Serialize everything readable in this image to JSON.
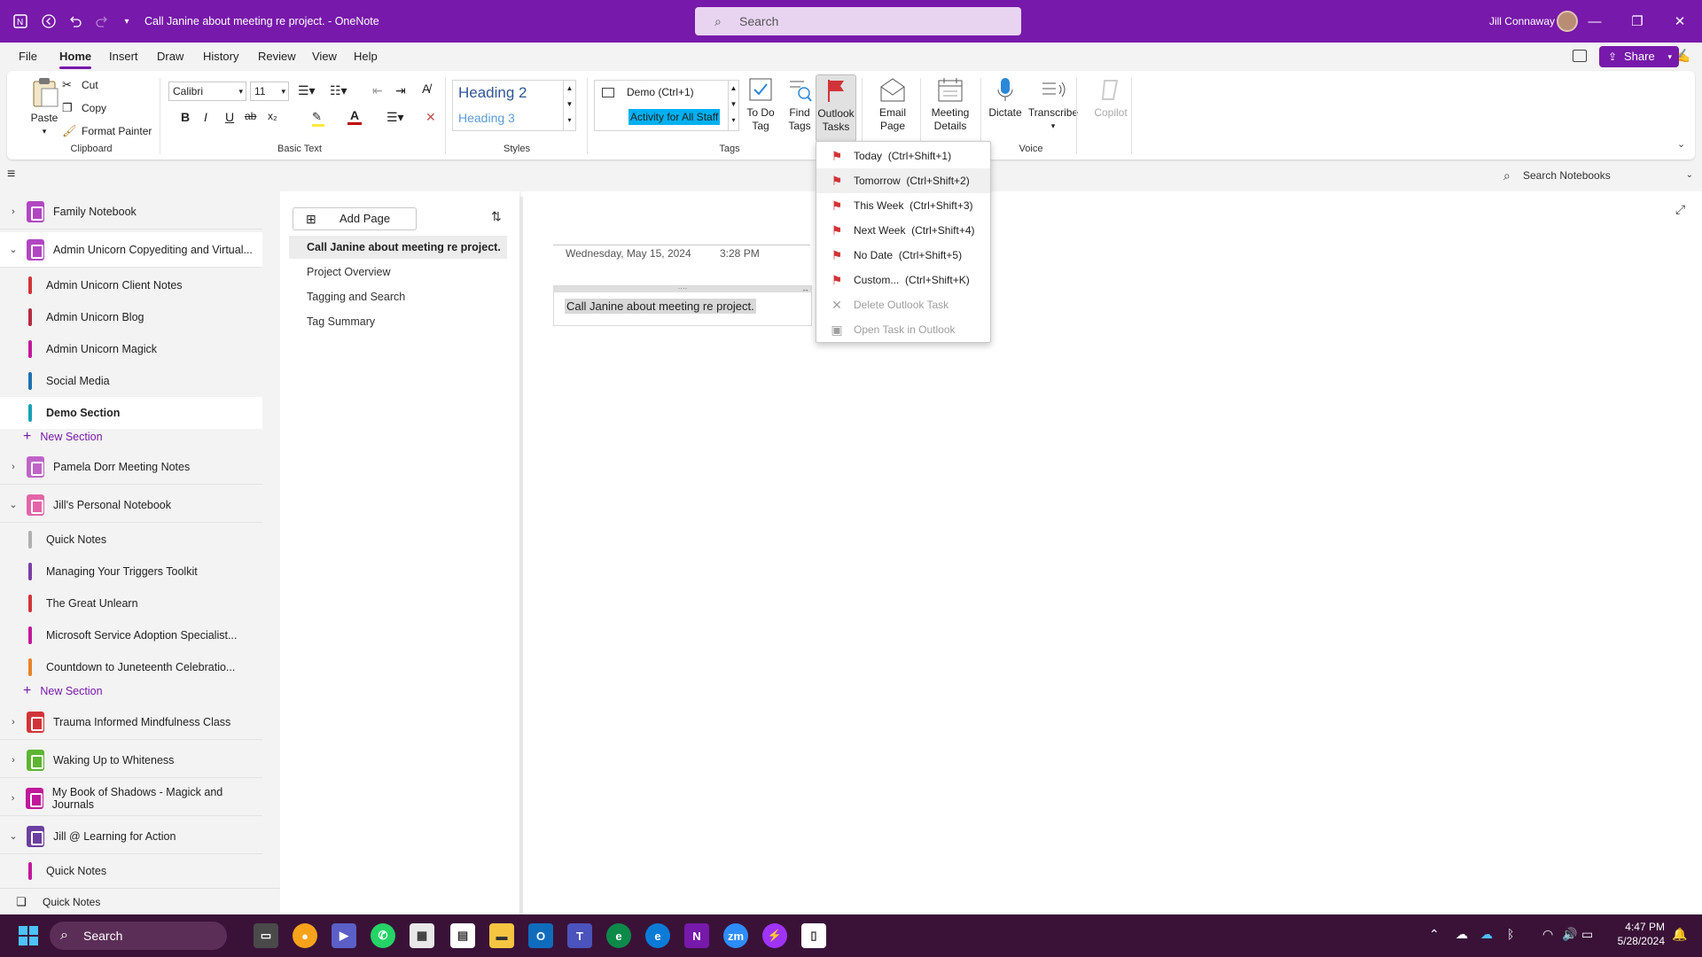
{
  "window": {
    "title": "Call Janine about meeting re project.  -  OneNote",
    "search_placeholder": "Search",
    "user_name": "Jill Connaway",
    "minimize": "—",
    "restore": "❐",
    "close": "✕"
  },
  "menu": {
    "tabs": [
      "File",
      "Home",
      "Insert",
      "Draw",
      "History",
      "Review",
      "View",
      "Help"
    ],
    "active": "Home",
    "share_label": "Share"
  },
  "ribbon": {
    "clipboard": {
      "paste": "Paste",
      "cut": "Cut",
      "copy": "Copy",
      "format_painter": "Format Painter",
      "label": "Clipboard"
    },
    "basic_text": {
      "font": "Calibri",
      "size": "11",
      "label": "Basic Text",
      "bold": "B",
      "italic": "I",
      "underline": "U",
      "strike": "ab",
      "subscript": "x₂"
    },
    "styles": {
      "heading2": "Heading 2",
      "heading3": "Heading 3",
      "label": "Styles"
    },
    "tags": {
      "tag1": "Demo (Ctrl+1)",
      "tag2": "Activity for All Staff",
      "todo_tag": [
        "To Do",
        "Tag"
      ],
      "find_tags": [
        "Find",
        "Tags"
      ],
      "outlook_tasks": [
        "Outlook",
        "Tasks ⌄"
      ],
      "label": "Tags"
    },
    "email_page": [
      "Email",
      "Page"
    ],
    "meeting_details": [
      "Meeting",
      "Details"
    ],
    "voice": {
      "dictate": "Dictate",
      "transcribe": "Transcribe",
      "label": "Voice"
    },
    "copilot": "Copilot"
  },
  "search_notebooks": "Search Notebooks",
  "sidebar": {
    "notebooks": [
      {
        "name": "Family Notebook",
        "expanded": false,
        "color": "#b146c2"
      },
      {
        "name": "Admin Unicorn Copyediting and Virtual...",
        "expanded": true,
        "color": "#b146c2"
      },
      {
        "name": "Pamela Dorr Meeting Notes",
        "expanded": false,
        "color": "#c064c8"
      },
      {
        "name": "Jill's Personal Notebook",
        "expanded": true,
        "color": "#e365a8"
      },
      {
        "name": "Trauma Informed Mindfulness Class",
        "expanded": false,
        "color": "#d13438"
      },
      {
        "name": "Waking Up to Whiteness",
        "expanded": false,
        "color": "#5db531"
      },
      {
        "name": "My Book of Shadows - Magick and Journals",
        "expanded": false,
        "color": "#c2189a"
      },
      {
        "name": "Jill @ Learning for Action",
        "expanded": true,
        "color": "#6b3fa0"
      }
    ],
    "sections_admin": [
      {
        "name": "Admin Unicorn Client Notes",
        "color": "#d13438"
      },
      {
        "name": "Admin Unicorn Blog",
        "color": "#b52b42"
      },
      {
        "name": "Admin Unicorn Magick",
        "color": "#c2189a"
      },
      {
        "name": "Social Media",
        "color": "#1e6fb0"
      },
      {
        "name": "Demo Section",
        "color": "#16a2b5"
      }
    ],
    "sections_personal": [
      {
        "name": "Quick Notes",
        "color": "#b0b0b0"
      },
      {
        "name": "Managing Your Triggers Toolkit",
        "color": "#7a3da8"
      },
      {
        "name": "The Great Unlearn",
        "color": "#d13438"
      },
      {
        "name": "Microsoft Service Adoption Specialist...",
        "color": "#c2189a"
      },
      {
        "name": "Countdown to Juneteenth Celebratio...",
        "color": "#e8822a"
      }
    ],
    "sections_jill": [
      {
        "name": "Quick Notes",
        "color": "#c2189a"
      }
    ],
    "new_section": "New Section",
    "footer_quick_notes": "Quick Notes"
  },
  "pages": {
    "add_page": "Add Page",
    "items": [
      "Call Janine about meeting re project.",
      "Project Overview",
      "Tagging and Search",
      "Tag Summary"
    ]
  },
  "note": {
    "date": "Wednesday, May 15, 2024",
    "time": "3:28 PM",
    "text": "Call Janine about meeting re project."
  },
  "outlook_menu": {
    "items": [
      {
        "label": "Today",
        "shortcut": "(Ctrl+Shift+1)",
        "enabled": true
      },
      {
        "label": "Tomorrow",
        "shortcut": "(Ctrl+Shift+2)",
        "enabled": true
      },
      {
        "label": "This Week",
        "shortcut": "(Ctrl+Shift+3)",
        "enabled": true
      },
      {
        "label": "Next Week",
        "shortcut": "(Ctrl+Shift+4)",
        "enabled": true
      },
      {
        "label": "No Date",
        "shortcut": "(Ctrl+Shift+5)",
        "enabled": true
      },
      {
        "label": "Custom...",
        "shortcut": "(Ctrl+Shift+K)",
        "enabled": true
      },
      {
        "label": "Delete Outlook Task",
        "shortcut": "",
        "enabled": false
      },
      {
        "label": "Open Task in Outlook",
        "shortcut": "",
        "enabled": false
      }
    ]
  },
  "taskbar": {
    "search": "Search",
    "time": "4:47 PM",
    "date": "5/28/2024"
  },
  "colors": {
    "accent": "#7719aa",
    "flag": "#d13438",
    "highlight": "#00b0f0"
  }
}
